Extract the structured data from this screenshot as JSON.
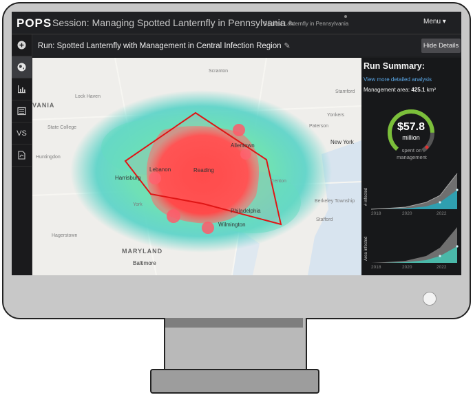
{
  "app": {
    "logo": "POPS",
    "session_title": "Session: Managing Spotted Lanternfly in Pennsylvania",
    "session_subtitle": "Spotted Lanternfly in Pennsylvania",
    "menu_label": "Menu"
  },
  "sidebar": {
    "items": [
      {
        "icon": "plus-circle-icon"
      },
      {
        "icon": "globe-icon"
      },
      {
        "icon": "bar-chart-icon"
      },
      {
        "icon": "list-icon"
      },
      {
        "label": "VS"
      },
      {
        "icon": "pdf-icon"
      }
    ]
  },
  "run": {
    "title": "Run: Spotted Lanternfly with Management in Central Infection Region",
    "hide_button": "Hide Details"
  },
  "map": {
    "labels": {
      "scranton": "Scranton",
      "lock_haven": "Lock Haven",
      "vania": "VANIA",
      "state_college": "State College",
      "huntingdon": "Huntingdon",
      "harrisburg": "Harrisburg",
      "lebanon": "Lebanon",
      "reading": "Reading",
      "allentown": "Allentown",
      "york": "York",
      "hagerstown": "Hagerstown",
      "philadelphia": "Philadelphia",
      "wilmington": "Wilmington",
      "trenton": "Trenton",
      "new_york": "New York",
      "yonkers": "Yonkers",
      "stamford": "Stamford",
      "paterson": "Paterson",
      "baltimore": "Baltimore",
      "maryland": "MARYLAND",
      "berkeley_township": "Berkeley Township",
      "stafford": "Stafford"
    }
  },
  "summary": {
    "title": "Run Summary:",
    "link": "View more detailed analysis",
    "area_label": "Management area:",
    "area_value": "425.1",
    "area_unit": "km²",
    "gauge_value": "$57.8",
    "gauge_unit": "million",
    "gauge_sub": "spent on management",
    "gauge_fraction": 0.8,
    "chart1_ylabel": "# infected",
    "chart2_ylabel": "Area infected",
    "x_ticks": [
      "2018",
      "2020",
      "2022"
    ],
    "colors": {
      "accent": "#5aa7e6",
      "gauge_green": "#7bbf3a",
      "gauge_red": "#e03030",
      "series_teal": "#2f9fb0",
      "series_gray": "#777777"
    }
  }
}
